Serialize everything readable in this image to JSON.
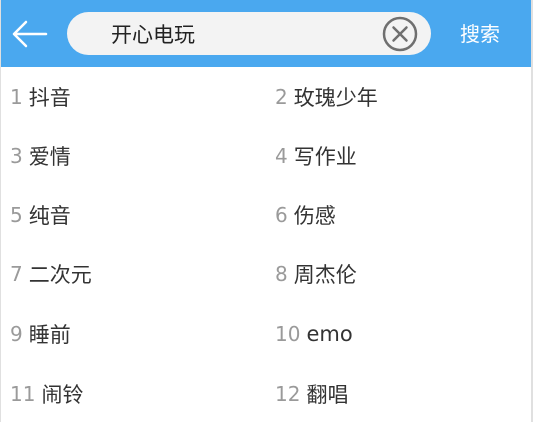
{
  "header": {
    "search": {
      "value": "开心电玩"
    },
    "search_button_label": "搜索",
    "colors": {
      "bar": "#4aa8ef",
      "search_bg": "#f3f3f3"
    }
  },
  "icons": {
    "back": "arrow-left-icon",
    "clear": "clear-circle-x-icon"
  },
  "hot_searches": [
    {
      "rank": "1",
      "label": "抖音"
    },
    {
      "rank": "2",
      "label": "玫瑰少年"
    },
    {
      "rank": "3",
      "label": "爱情"
    },
    {
      "rank": "4",
      "label": "写作业"
    },
    {
      "rank": "5",
      "label": "纯音"
    },
    {
      "rank": "6",
      "label": "伤感"
    },
    {
      "rank": "7",
      "label": "二次元"
    },
    {
      "rank": "8",
      "label": "周杰伦"
    },
    {
      "rank": "9",
      "label": "睡前"
    },
    {
      "rank": "10",
      "label": "emo"
    },
    {
      "rank": "11",
      "label": "闹铃"
    },
    {
      "rank": "12",
      "label": "翻唱"
    }
  ]
}
